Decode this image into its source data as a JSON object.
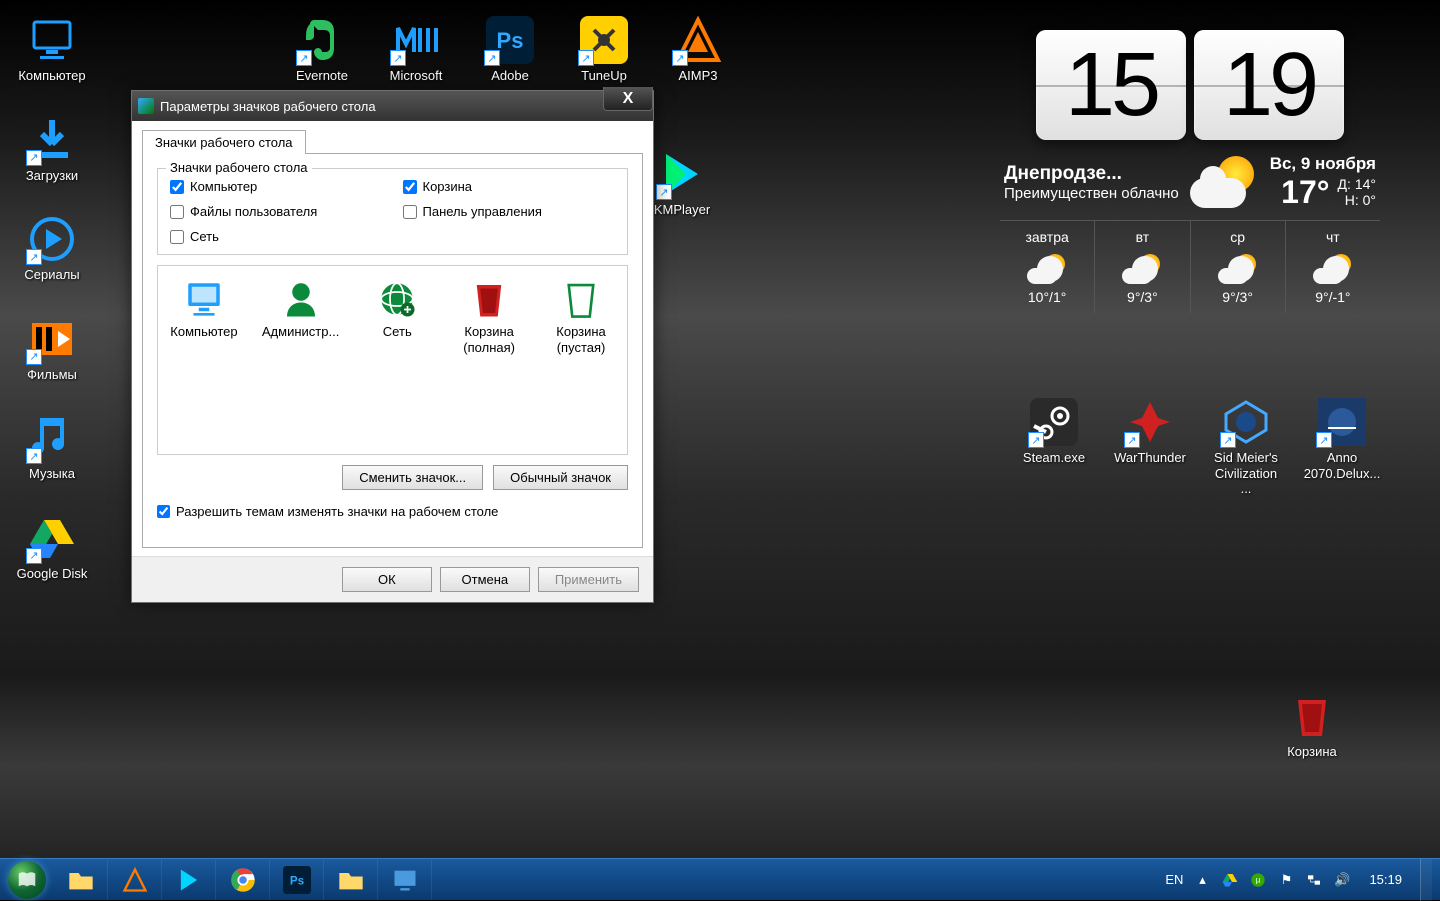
{
  "dialog": {
    "title": "Параметры значков рабочего стола",
    "tab": "Значки рабочего стола",
    "fieldset_legend": "Значки рабочего стола",
    "checks": {
      "computer": "Компьютер",
      "bin": "Корзина",
      "userfiles": "Файлы пользователя",
      "controlpanel": "Панель управления",
      "network": "Сеть"
    },
    "icons": {
      "computer": "Компьютер",
      "admin": "Администр...",
      "network": "Сеть",
      "bin_full": "Корзина (полная)",
      "bin_empty": "Корзина (пустая)"
    },
    "btn_change": "Сменить значок...",
    "btn_default": "Обычный значок",
    "allow_themes": "Разрешить темам изменять значки на рабочем столе",
    "btn_ok": "ОК",
    "btn_cancel": "Отмена",
    "btn_apply": "Применить"
  },
  "desktop_icons": {
    "computer": "Компьютер",
    "downloads": "Загрузки",
    "serials": "Сериалы",
    "films": "Фильмы",
    "music": "Музыка",
    "gdisk": "Google Disk",
    "evernote": "Evernote",
    "microsoft": "Microsoft",
    "adobe": "Adobe",
    "tuneup": "TuneUp",
    "aimp3": "AIMP3",
    "kmplayer": "KMPlayer",
    "steam": "Steam.exe",
    "warthunder": "WarThunder",
    "civ": "Sid Meier's Civilization ...",
    "anno": "Anno 2070.Delux...",
    "bin": "Корзина"
  },
  "weather": {
    "hours": "15",
    "minutes": "19",
    "location": "Днепродзе...",
    "date": "Вс, 9 ноября",
    "condition": "Преимуществен облачно",
    "temp": "17°",
    "high_label": "Д:",
    "high": "14°",
    "low_label": "Н:",
    "low": "0°",
    "forecast": [
      {
        "day": "завтра",
        "temp": "10°/1°"
      },
      {
        "day": "вт",
        "temp": "9°/3°"
      },
      {
        "day": "ср",
        "temp": "9°/3°"
      },
      {
        "day": "чт",
        "temp": "9°/-1°"
      }
    ]
  },
  "taskbar": {
    "lang": "EN",
    "clock": "15:19"
  }
}
